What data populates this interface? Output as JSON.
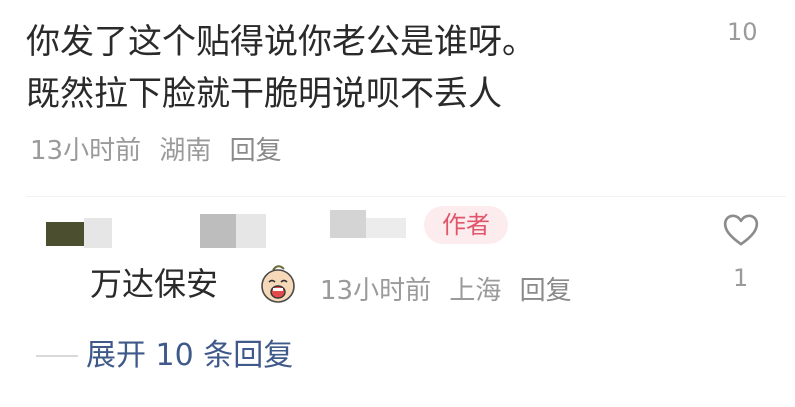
{
  "comment": {
    "text_line1": "你发了这个贴得说你老公是谁呀。",
    "text_line2": "既然拉下脸就干脆明说呗不丢人",
    "time": "13小时前",
    "location": "湖南",
    "reply_label": "回复",
    "like_count": "10"
  },
  "reply": {
    "author_badge": "作者",
    "text": "万达保安",
    "emoji_icon": "crying-face-icon",
    "time": "13小时前",
    "location": "上海",
    "reply_label": "回复",
    "like_count": "1",
    "like_icon": "heart-outline-icon"
  },
  "expand": {
    "label": "展开 10 条回复"
  },
  "colors": {
    "badge_bg": "#fdecee",
    "badge_text": "#e0556a",
    "link": "#3f5a8a",
    "meta": "#9a9a9a"
  }
}
